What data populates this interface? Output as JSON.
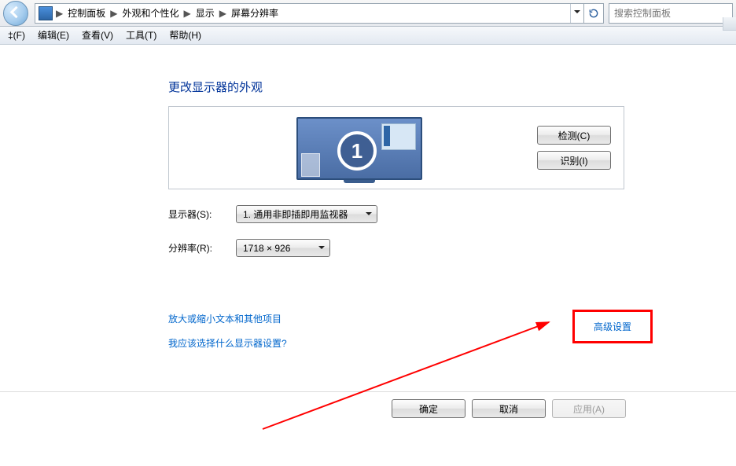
{
  "breadcrumb": {
    "items": [
      "控制面板",
      "外观和个性化",
      "显示",
      "屏幕分辨率"
    ]
  },
  "search": {
    "placeholder": "搜索控制面板"
  },
  "menubar": {
    "file": "‡(F)",
    "edit": "编辑(E)",
    "view": "查看(V)",
    "tools": "工具(T)",
    "help": "帮助(H)"
  },
  "page": {
    "heading": "更改显示器的外观",
    "monitor_number": "1",
    "detect_btn": "检测(C)",
    "identify_btn": "识别(I)",
    "display_label": "显示器(S):",
    "display_value": "1. 通用非即插即用监视器",
    "resolution_label": "分辨率(R):",
    "resolution_value": "1718 × 926",
    "advanced_link": "高级设置",
    "zoom_link": "放大或缩小文本和其他项目",
    "which_link": "我应该选择什么显示器设置?",
    "ok_btn": "确定",
    "cancel_btn": "取消",
    "apply_btn": "应用(A)"
  }
}
